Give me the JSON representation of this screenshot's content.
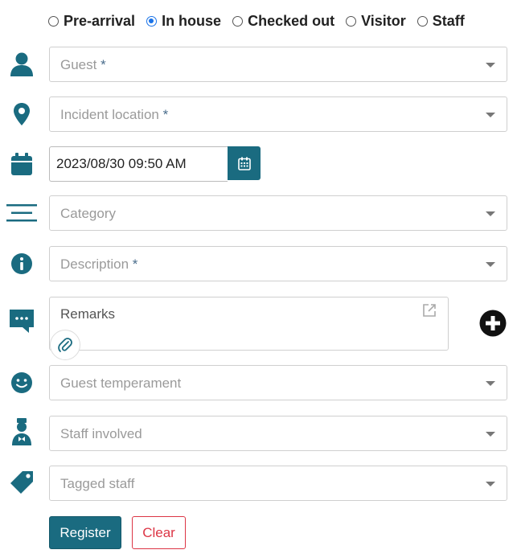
{
  "guest_type": {
    "options": [
      {
        "label": "Pre-arrival",
        "checked": false
      },
      {
        "label": "In house",
        "checked": true
      },
      {
        "label": "Checked out",
        "checked": false
      },
      {
        "label": "Visitor",
        "checked": false
      },
      {
        "label": "Staff",
        "checked": false
      }
    ]
  },
  "fields": {
    "guest": {
      "placeholder": "Guest",
      "required_mark": "*"
    },
    "incident_location": {
      "placeholder": "Incident location",
      "required_mark": "*"
    },
    "datetime": {
      "value": "2023/08/30 09:50 AM"
    },
    "category": {
      "placeholder": "Category"
    },
    "description": {
      "placeholder": "Description",
      "required_mark": "*"
    },
    "remarks": {
      "placeholder": "Remarks"
    },
    "guest_temperament": {
      "placeholder": "Guest temperament"
    },
    "staff_involved": {
      "placeholder": "Staff involved"
    },
    "tagged_staff": {
      "placeholder": "Tagged staff"
    }
  },
  "buttons": {
    "register": "Register",
    "clear": "Clear"
  },
  "colors": {
    "icon": "#1a6b80",
    "primary": "#1a6b80",
    "danger": "#dc3545",
    "radio_selected": "#1a73e8"
  },
  "icons": [
    "user-icon",
    "location-pin-icon",
    "calendar-icon",
    "category-lines-icon",
    "info-icon",
    "chat-icon",
    "smiley-icon",
    "staff-icon",
    "tag-icon",
    "attach-icon",
    "add-circle-icon",
    "expand-icon"
  ]
}
